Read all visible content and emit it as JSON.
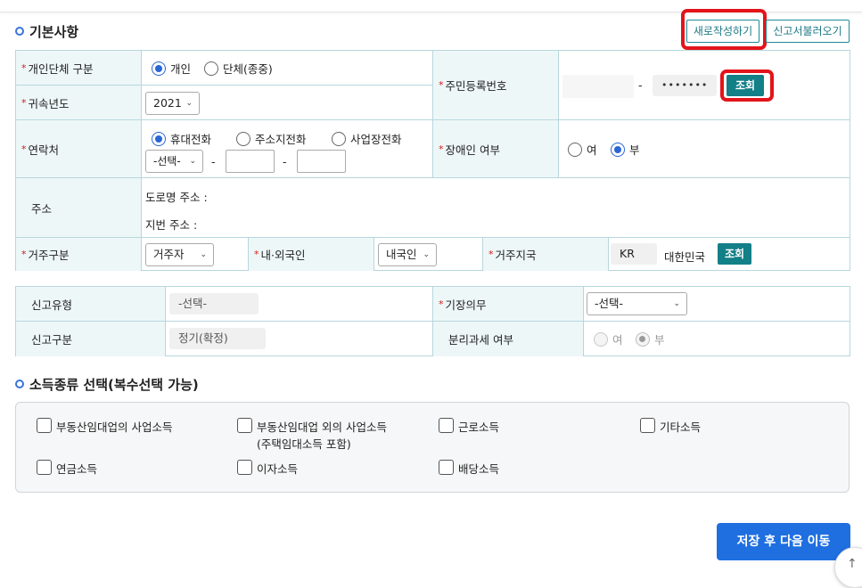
{
  "sections": {
    "basic": "기본사항",
    "income": "소득종류 선택(복수선택 가능)"
  },
  "header_buttons": {
    "new": "새로작성하기",
    "load": "신고서불러오기"
  },
  "basic": {
    "type_label": "개인단체 구분",
    "type_options": [
      "개인",
      "단체(종중)"
    ],
    "year_label": "귀속년도",
    "year_value": "2021",
    "rrn_label": "주민등록번호",
    "rrn_dash": "-",
    "rrn_back_masked": "•••••••",
    "lookup": "조회",
    "contact_label": "연락처",
    "contact_options": [
      "휴대전화",
      "주소지전화",
      "사업장전화"
    ],
    "phone_prefix": "-선택-",
    "phone_dash": "-",
    "disabled_label": "장애인 여부",
    "disabled_options": [
      "여",
      "부"
    ],
    "address_label": "주소",
    "road_address": "도로명 주소 :",
    "lot_address": "지번 주소 :",
    "residence_label": "거주구분",
    "residence_value": "거주자",
    "nationality_label": "내·외국인",
    "nationality_value": "내국인",
    "country_label": "거주지국",
    "country_code": "KR",
    "country_name": "대한민국"
  },
  "report": {
    "report_type_label": "신고유형",
    "report_type_value": "-선택-",
    "bookkeeping_label": "기장의무",
    "bookkeeping_value": "-선택-",
    "report_class_label": "신고구분",
    "report_class_value": "정기(확정)",
    "separate_tax_label": "분리과세 여부",
    "separate_tax_options": [
      "여",
      "부"
    ]
  },
  "income_types": [
    {
      "label": "부동산임대업의 사업소득",
      "label2": ""
    },
    {
      "label": "부동산임대업 외의 사업소득",
      "label2": "(주택임대소득 포함)"
    },
    {
      "label": "근로소득",
      "label2": ""
    },
    {
      "label": "기타소득",
      "label2": ""
    },
    {
      "label": "연금소득",
      "label2": ""
    },
    {
      "label": "이자소득",
      "label2": ""
    },
    {
      "label": "배당소득",
      "label2": ""
    }
  ],
  "footer": {
    "save_next": "저장 후 다음 이동"
  },
  "icons": {
    "scroll_top": "arrow-up-icon",
    "section_marker": "circle-bullet-icon"
  },
  "colors": {
    "accent_teal": "#137f87",
    "primary_blue": "#1f6fe0",
    "highlight_red": "#e3141b",
    "header_bg": "#eef7f8"
  }
}
